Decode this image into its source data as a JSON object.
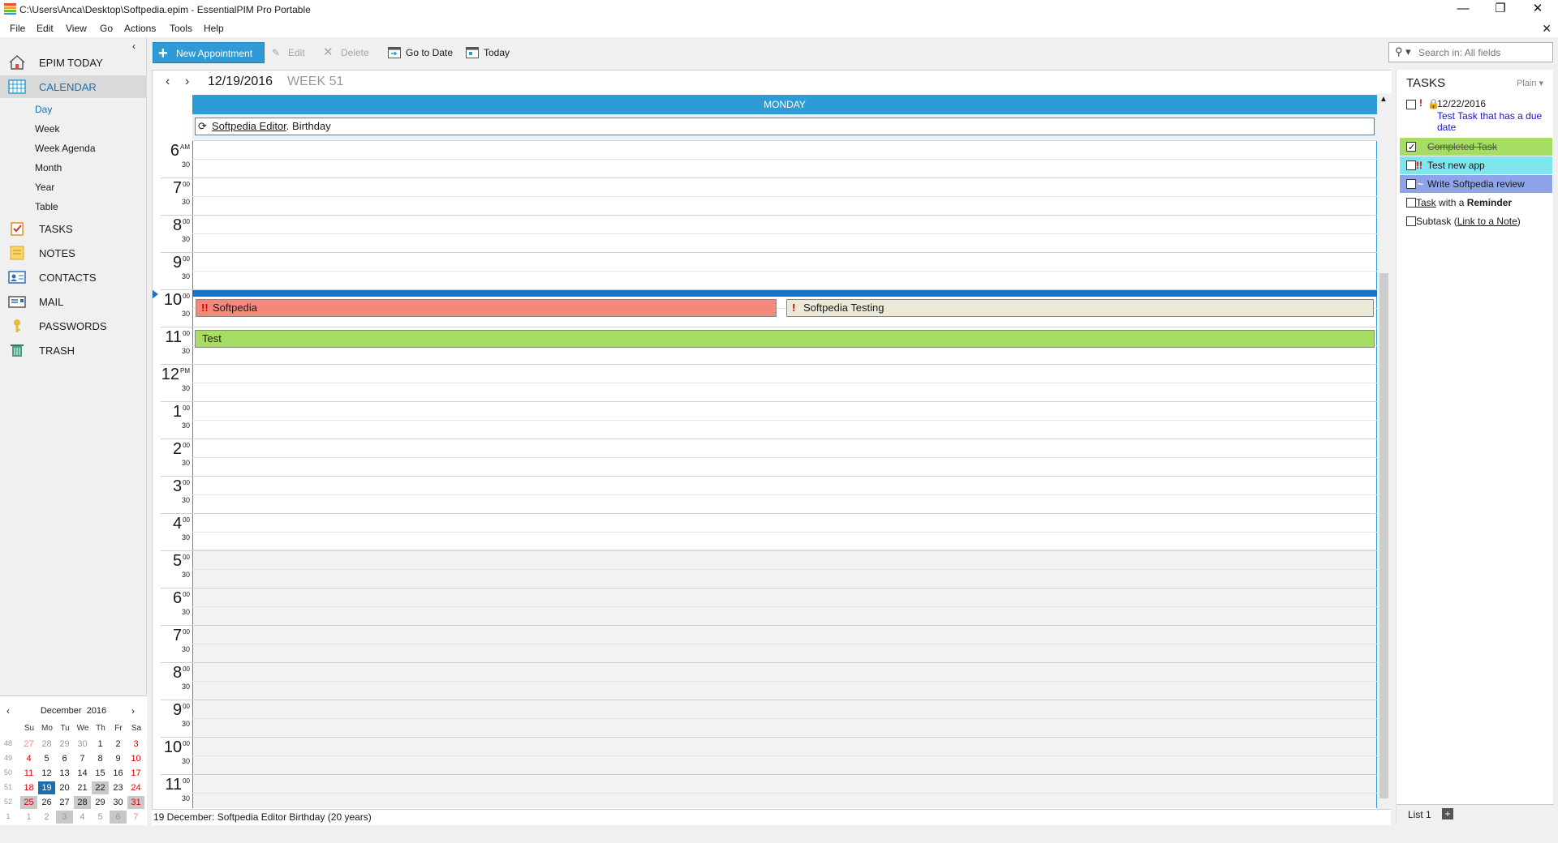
{
  "window": {
    "title": "C:\\Users\\Anca\\Desktop\\Softpedia.epim - EssentialPIM Pro Portable",
    "minimize_icon": "minimize-icon",
    "restore_icon": "restore-icon",
    "close_icon": "close-icon"
  },
  "menu": [
    "File",
    "Edit",
    "View",
    "Go",
    "Actions",
    "Tools",
    "Help"
  ],
  "toolbar": {
    "new_appointment": "New Appointment",
    "edit": "Edit",
    "delete": "Delete",
    "go_to_date": "Go to Date",
    "today": "Today"
  },
  "search": {
    "placeholder": "Search in: All fields"
  },
  "sidebar": {
    "modules": [
      {
        "label": "EPIM TODAY",
        "icon": "home-icon"
      },
      {
        "label": "CALENDAR",
        "icon": "calendar-icon"
      },
      {
        "label": "TASKS",
        "icon": "tasks-icon"
      },
      {
        "label": "NOTES",
        "icon": "notes-icon"
      },
      {
        "label": "CONTACTS",
        "icon": "contacts-icon"
      },
      {
        "label": "MAIL",
        "icon": "mail-icon"
      },
      {
        "label": "PASSWORDS",
        "icon": "key-icon"
      },
      {
        "label": "TRASH",
        "icon": "trash-icon"
      }
    ],
    "calendar_views": [
      "Day",
      "Week",
      "Week Agenda",
      "Month",
      "Year",
      "Table"
    ],
    "selected_view": "Day"
  },
  "mini_calendar": {
    "month": "December",
    "year": "2016",
    "weekdays": [
      "Su",
      "Mo",
      "Tu",
      "We",
      "Th",
      "Fr",
      "Sa"
    ],
    "weeks": [
      {
        "num": "48",
        "days": [
          "27",
          "28",
          "29",
          "30",
          "1",
          "2",
          "3"
        ]
      },
      {
        "num": "49",
        "days": [
          "4",
          "5",
          "6",
          "7",
          "8",
          "9",
          "10"
        ]
      },
      {
        "num": "50",
        "days": [
          "11",
          "12",
          "13",
          "14",
          "15",
          "16",
          "17"
        ]
      },
      {
        "num": "51",
        "days": [
          "18",
          "19",
          "20",
          "21",
          "22",
          "23",
          "24"
        ]
      },
      {
        "num": "52",
        "days": [
          "25",
          "26",
          "27",
          "28",
          "29",
          "30",
          "31"
        ]
      },
      {
        "num": "1",
        "days": [
          "1",
          "2",
          "3",
          "4",
          "5",
          "6",
          "7"
        ]
      }
    ],
    "today": "19"
  },
  "calendar": {
    "date": "12/19/2016",
    "week": "WEEK 51",
    "day_name": "MONDAY",
    "all_day": {
      "title": "Softpedia Editor",
      "suffix": ". Birthday"
    },
    "hours": [
      {
        "h": "6",
        "ampm": "AM"
      },
      {
        "h": "7",
        "ampm": "00"
      },
      {
        "h": "8",
        "ampm": "00"
      },
      {
        "h": "9",
        "ampm": "00"
      },
      {
        "h": "10",
        "ampm": "00"
      },
      {
        "h": "11",
        "ampm": "00"
      },
      {
        "h": "12",
        "ampm": "PM"
      },
      {
        "h": "1",
        "ampm": "00"
      },
      {
        "h": "2",
        "ampm": "00"
      },
      {
        "h": "3",
        "ampm": "00"
      },
      {
        "h": "4",
        "ampm": "00"
      },
      {
        "h": "5",
        "ampm": "00"
      },
      {
        "h": "6",
        "ampm": "00"
      },
      {
        "h": "7",
        "ampm": "00"
      },
      {
        "h": "8",
        "ampm": "00"
      },
      {
        "h": "9",
        "ampm": "00"
      },
      {
        "h": "10",
        "ampm": "00"
      },
      {
        "h": "11",
        "ampm": "00"
      }
    ],
    "half_label": "30",
    "events": [
      {
        "title": "Softpedia",
        "priority": "!!",
        "color": "#f28a7b"
      },
      {
        "title": "Softpedia Testing",
        "priority": "!",
        "color": "#ece9d8"
      },
      {
        "title": "Test",
        "priority": "",
        "color": "#a7dd62"
      }
    ]
  },
  "status": {
    "text": "19 December:  Softpedia Editor Birthday  (20 years)"
  },
  "tasks": {
    "header": "TASKS",
    "view": "Plain",
    "items": [
      {
        "date": "12/22/2016",
        "title": "Test Task that has a due date",
        "priority": "!",
        "checked": false
      },
      {
        "title": "Completed Task",
        "checked": true,
        "color": "#a7dd62"
      },
      {
        "title": "Test new app",
        "priority": "!!",
        "checked": false,
        "color": "#7ee6ee"
      },
      {
        "title": "Write Softpedia review",
        "checked": false,
        "color": "#8fa4e8"
      },
      {
        "title_a": "Task",
        "title_b": " with a ",
        "title_c": "Reminder",
        "checked": false
      },
      {
        "title_a": "Subtask (",
        "title_b": "Link to a Note",
        "title_c": ")",
        "checked": false
      }
    ],
    "list_tab": "List 1"
  }
}
